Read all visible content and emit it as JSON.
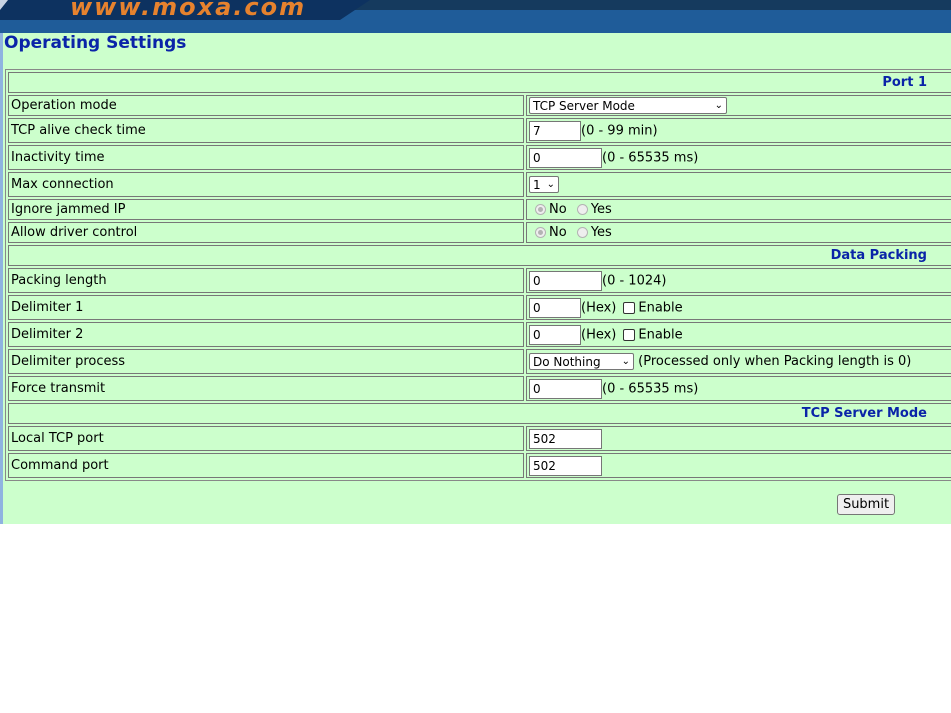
{
  "banner": {
    "logo_text": "www.moxa.com"
  },
  "page": {
    "title": "Operating Settings"
  },
  "sections": {
    "port": "Port 1",
    "data_packing": "Data Packing",
    "tcp_server": "TCP Server Mode"
  },
  "rows": {
    "operation_mode": {
      "label": "Operation mode",
      "value": "TCP Server Mode"
    },
    "tcp_alive": {
      "label": "TCP alive check time",
      "value": "7",
      "hint": "(0 - 99 min)"
    },
    "inactivity": {
      "label": "Inactivity time",
      "value": "0",
      "hint": "(0 - 65535 ms)"
    },
    "max_connection": {
      "label": "Max connection",
      "value": "1"
    },
    "ignore_jammed": {
      "label": "Ignore jammed IP",
      "no": "No",
      "yes": "Yes",
      "selected": "No"
    },
    "allow_driver": {
      "label": "Allow driver control",
      "no": "No",
      "yes": "Yes",
      "selected": "No"
    },
    "packing_length": {
      "label": "Packing length",
      "value": "0",
      "hint": "(0 - 1024)"
    },
    "delimiter1": {
      "label": "Delimiter 1",
      "value": "0",
      "hint": "(Hex)",
      "enable": "Enable"
    },
    "delimiter2": {
      "label": "Delimiter 2",
      "value": "0",
      "hint": "(Hex)",
      "enable": "Enable"
    },
    "delimiter_process": {
      "label": "Delimiter process",
      "value": "Do Nothing",
      "hint": "(Processed only when Packing length is 0)"
    },
    "force_transmit": {
      "label": "Force transmit",
      "value": "0",
      "hint": "(0 - 65535 ms)"
    },
    "local_tcp_port": {
      "label": "Local TCP port",
      "value": "502"
    },
    "command_port": {
      "label": "Command port",
      "value": "502"
    }
  },
  "submit_label": "Submit",
  "colors": {
    "background": "#ccffcc",
    "heading": "#0a24a8",
    "banner": "#1f5c99",
    "logo": "#e6822e"
  }
}
